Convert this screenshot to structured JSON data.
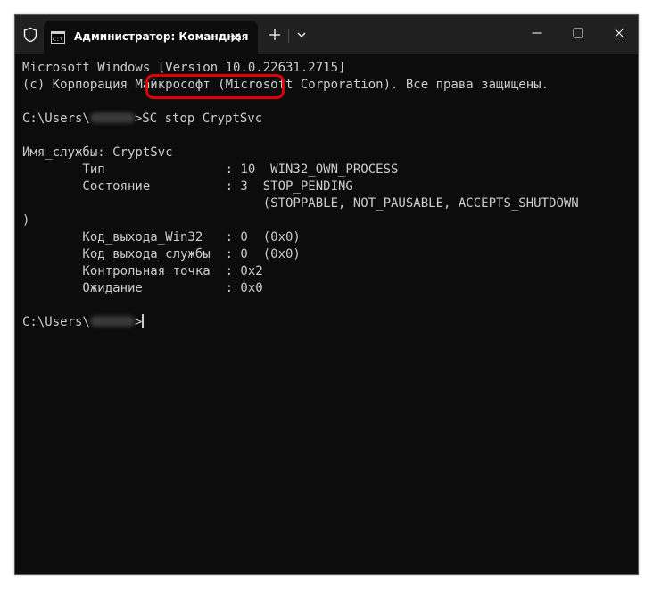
{
  "window": {
    "tab_title": "Администратор: Командная",
    "icons": {
      "shield": "shield-icon",
      "terminal": "terminal-icon",
      "close_tab": "close-icon",
      "new_tab": "plus-icon",
      "dropdown": "chevron-down-icon",
      "minimize": "minimize-icon",
      "maximize": "maximize-icon",
      "close_window": "close-icon"
    }
  },
  "colors": {
    "console_bg": "#0c0c0c",
    "titlebar_bg": "#202020",
    "text": "#cccccc",
    "highlight": "#e00000"
  },
  "console": {
    "header1": "Microsoft Windows [Version 10.0.22631.2715]",
    "header2": "(c) Корпорация Майкрософт (Microsoft Corporation). Все права защищены.",
    "prompt1_prefix": "C:\\Users\\",
    "prompt1_suffix": ">",
    "command": "SC stop CryptSvc",
    "service_line": "Имя_службы: CryptSvc",
    "type_line": "        Тип                : 10  WIN32_OWN_PROCESS",
    "state_line": "        Состояние          : 3  STOP_PENDING",
    "flags_line": "                                (STOPPABLE, NOT_PAUSABLE, ACCEPTS_SHUTDOWN",
    "flags_close": ")",
    "win32_exit_line": "        Код_выхода_Win32   : 0  (0x0)",
    "service_exit_line": "        Код_выхода_службы  : 0  (0x0)",
    "checkpoint_line": "        Контрольная_точка  : 0x2",
    "wait_line": "        Ожидание           : 0x0",
    "prompt2_prefix": "C:\\Users\\",
    "prompt2_suffix": ">"
  }
}
